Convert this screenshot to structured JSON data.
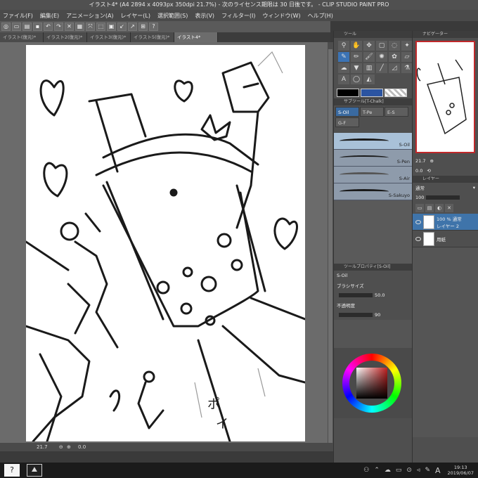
{
  "window": {
    "title": "イラスト4* (A4 2894 x 4093px 350dpi 21.7%)  - 次のライセンス期限は 30 日後です。 - CLIP STUDIO PAINT PRO"
  },
  "menu": {
    "items": [
      "ファイル(F)",
      "編集(E)",
      "アニメーション(A)",
      "レイヤー(L)",
      "選択範囲(S)",
      "表示(V)",
      "フィルター(I)",
      "ウィンドウ(W)",
      "ヘルプ(H)"
    ]
  },
  "tabs": [
    {
      "label": "イラスト(復元)*"
    },
    {
      "label": "イラスト2(復元)*"
    },
    {
      "label": "イラスト3(復元)*"
    },
    {
      "label": "イラスト5(復元)*"
    },
    {
      "label": "イラスト4*"
    }
  ],
  "canvas_status": {
    "zoom": "21.7",
    "angle": "0.0"
  },
  "tool_panel": {
    "header": "ツール",
    "icons": [
      "pen-icon",
      "brush-icon",
      "eraser-icon",
      "fill-icon",
      "gradient-icon",
      "text-icon",
      "lasso-icon",
      "move-icon",
      "zoom-icon",
      "eyedropper-icon",
      "hand-icon",
      "select-icon"
    ]
  },
  "subtool": {
    "header": "サブツール[T-Chalk]",
    "tabs": [
      "S-Oil",
      "T-Pe",
      "E-S",
      "G-F"
    ],
    "brushes": [
      {
        "name": "S-Oil",
        "selected": true
      },
      {
        "name": "S-Pen",
        "selected": false
      },
      {
        "name": "S-Air",
        "selected": false
      },
      {
        "name": "S-Sakuyo",
        "selected": false
      }
    ]
  },
  "tool_property": {
    "header": "ツールプロパティ[S-Oil]",
    "brush_label": "S-Oil",
    "size_label": "ブラシサイズ",
    "size_value": "50.0",
    "opacity_label": "不透明度",
    "opacity_value": "90"
  },
  "color": {
    "main": "#000000",
    "sub": "#2b54a1",
    "selected_hue": "#c02020"
  },
  "navigator": {
    "header": "ナビゲーター",
    "zoom": "21.7",
    "angle": "0.0"
  },
  "layers": {
    "header": "レイヤー",
    "blend_mode": "通常",
    "opacity": "100",
    "items": [
      {
        "name": "100 % 通常",
        "sub": "レイヤー 2",
        "selected": true
      },
      {
        "name": "用紙",
        "sub": "",
        "selected": false
      }
    ]
  },
  "taskbar": {
    "time": "19:13",
    "date": "2019/06/07",
    "ime": "A"
  }
}
